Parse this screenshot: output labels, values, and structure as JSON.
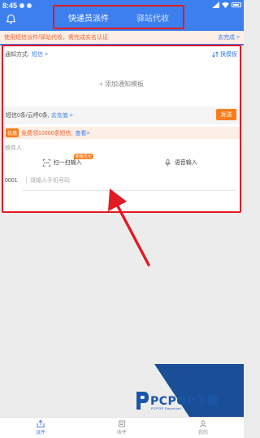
{
  "status": {
    "time": "8:45"
  },
  "header": {
    "tabs": [
      {
        "label": "快递员派件"
      },
      {
        "label": "驿站代收"
      }
    ]
  },
  "notice": {
    "message": "使用短信派件/驿站代收，需完成实名认证",
    "link": "去完成 >"
  },
  "form": {
    "notify_label": "通知方式:",
    "notify_value": "短信 >",
    "change_template": "换模板",
    "add_template": "+ 添加通知模板",
    "sms_status": "短信0条/云呼0条,",
    "recharge": "去充值 >",
    "send": "发送",
    "promo_badge": "优惠",
    "promo_text": "免费领10000条短信,",
    "promo_more": "查看>",
    "recipient_label": "收件人",
    "scan_input": "扫一扫输入",
    "scan_badge": "新版优化",
    "voice_input": "语音输入",
    "row_index": "0001",
    "phone_placeholder": "请输入手机号码"
  },
  "watermark": {
    "text": "PCPOP下载",
    "sub": "PCPOP Download"
  },
  "bottom_nav": [
    {
      "label": "派件"
    },
    {
      "label": "收件"
    },
    {
      "label": "我的"
    }
  ],
  "colors": {
    "primary": "#3d7fee",
    "highlight_box": "#e21b23",
    "orange": "#f97d1c",
    "notice_bg": "#fdeee6"
  }
}
